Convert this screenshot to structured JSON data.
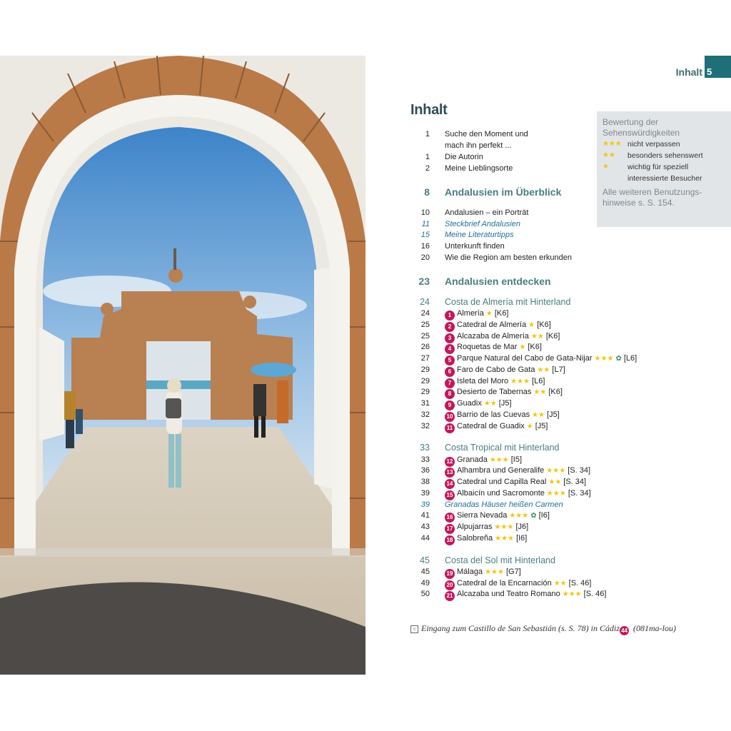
{
  "header": {
    "label": "Inhalt",
    "page_number": "5"
  },
  "title": "Inhalt",
  "rating_box": {
    "heading": "Bewertung der Sehenswürdigkeiten",
    "rows": [
      {
        "stars": "★★★",
        "text": "nicht verpassen"
      },
      {
        "stars": "★★",
        "text": "besonders sehenswert"
      },
      {
        "stars": "★",
        "text": "wichtig für speziell interessierte Besucher"
      }
    ],
    "note": "Alle weiteren Benutzungs­hinweise s. S. 154."
  },
  "toc": {
    "intro": [
      {
        "page": "1",
        "text": "Suche den Moment und"
      },
      {
        "page": "",
        "text": "mach ihn perfekt ..."
      },
      {
        "page": "1",
        "text": "Die Autorin"
      },
      {
        "page": "2",
        "text": "Meine Lieblingsorte"
      }
    ],
    "chapter1": {
      "page": "8",
      "text": "Andalusien im Überblick"
    },
    "chapter1_items": [
      {
        "page": "10",
        "text": "Andalusien – ein Porträt"
      },
      {
        "page": "11",
        "text": "Steckbrief Andalusien"
      },
      {
        "page": "15",
        "text": "Meine Literaturtipps"
      },
      {
        "page": "16",
        "text": "Unterkunft finden"
      },
      {
        "page": "20",
        "text": "Wie die Region am besten erkunden"
      }
    ],
    "chapter2": {
      "page": "23",
      "text": "Andalusien entdecken"
    },
    "region1": {
      "page": "24",
      "text": "Costa de Almería mit Hinterland"
    },
    "region1_items": [
      {
        "page": "24",
        "num": "1",
        "name": "Almería",
        "stars": "★",
        "ref": "[K6]"
      },
      {
        "page": "25",
        "num": "2",
        "name": "Catedral de Almería",
        "stars": "★",
        "ref": "[K6]"
      },
      {
        "page": "25",
        "num": "3",
        "name": "Alcazaba de Almería",
        "stars": "★★",
        "ref": "[K6]"
      },
      {
        "page": "26",
        "num": "4",
        "name": "Roquetas de Mar",
        "stars": "★",
        "ref": "[K6]"
      },
      {
        "page": "27",
        "num": "5",
        "name": "Parque Natural del Cabo de Gata-Nijar",
        "stars": "★★★",
        "leaf": "✿",
        "ref": "[L6]"
      },
      {
        "page": "29",
        "num": "6",
        "name": "Faro de Cabo de Gata",
        "stars": "★★",
        "ref": "[L7]"
      },
      {
        "page": "29",
        "num": "7",
        "name": "Isleta del Moro",
        "stars": "★★★",
        "ref": "[L6]"
      },
      {
        "page": "29",
        "num": "8",
        "name": "Desierto de Tabernas",
        "stars": "★★",
        "ref": "[K6]"
      },
      {
        "page": "31",
        "num": "9",
        "name": "Guadix",
        "stars": "★★",
        "ref": "[J5]"
      },
      {
        "page": "32",
        "num": "10",
        "name": "Barrio de las Cuevas",
        "stars": "★★",
        "ref": "[J5]"
      },
      {
        "page": "32",
        "num": "11",
        "name": "Catedral de Guadix",
        "stars": "★",
        "ref": "[J5]"
      }
    ],
    "region2": {
      "page": "33",
      "text": "Costa Tropical mit Hinterland"
    },
    "region2_items": [
      {
        "page": "33",
        "num": "12",
        "name": "Granada",
        "stars": "★★★",
        "ref": "[I5]"
      },
      {
        "page": "36",
        "num": "13",
        "name": "Alhambra und Generalife",
        "stars": "★★★",
        "ref": "[S. 34]"
      },
      {
        "page": "38",
        "num": "14",
        "name": "Catedral und Capilla Real",
        "stars": "★★",
        "ref": "[S. 34]"
      },
      {
        "page": "39",
        "num": "15",
        "name": "Albaicín und Sacromonte",
        "stars": "★★★",
        "ref": "[S. 34]"
      }
    ],
    "region2_italic": {
      "page": "39",
      "text": "Granadas Häuser heißen Carmen"
    },
    "region2_items_b": [
      {
        "page": "41",
        "num": "16",
        "name": "Sierra Nevada",
        "stars": "★★★",
        "leaf": "✿",
        "ref": "[I6]"
      },
      {
        "page": "43",
        "num": "17",
        "name": "Alpujarras",
        "stars": "★★★",
        "ref": "[J6]"
      },
      {
        "page": "44",
        "num": "18",
        "name": "Salobreña",
        "stars": "★★★",
        "ref": "[I6]"
      }
    ],
    "region3": {
      "page": "45",
      "text": "Costa del Sol mit Hinterland"
    },
    "region3_items": [
      {
        "page": "45",
        "num": "19",
        "name": "Málaga",
        "stars": "★★★",
        "ref": "[G7]"
      },
      {
        "page": "49",
        "num": "20",
        "name": "Catedral de la Encarnación",
        "stars": "★★",
        "ref": "[S. 46]"
      },
      {
        "page": "50",
        "num": "21",
        "name": "Alcazaba und Teatro Romano",
        "stars": "★★★",
        "ref": "[S. 46]"
      }
    ]
  },
  "caption": {
    "arrow": "<",
    "text_before": "Eingang zum Castillo de San Sebastián (s. S. 78) in Cádiz",
    "badge": "44",
    "text_after": " (081ma-lou)"
  },
  "colors": {
    "accent_teal": "#1f6f78",
    "badge_magenta": "#c2185b",
    "star_yellow": "#f1c40f"
  }
}
